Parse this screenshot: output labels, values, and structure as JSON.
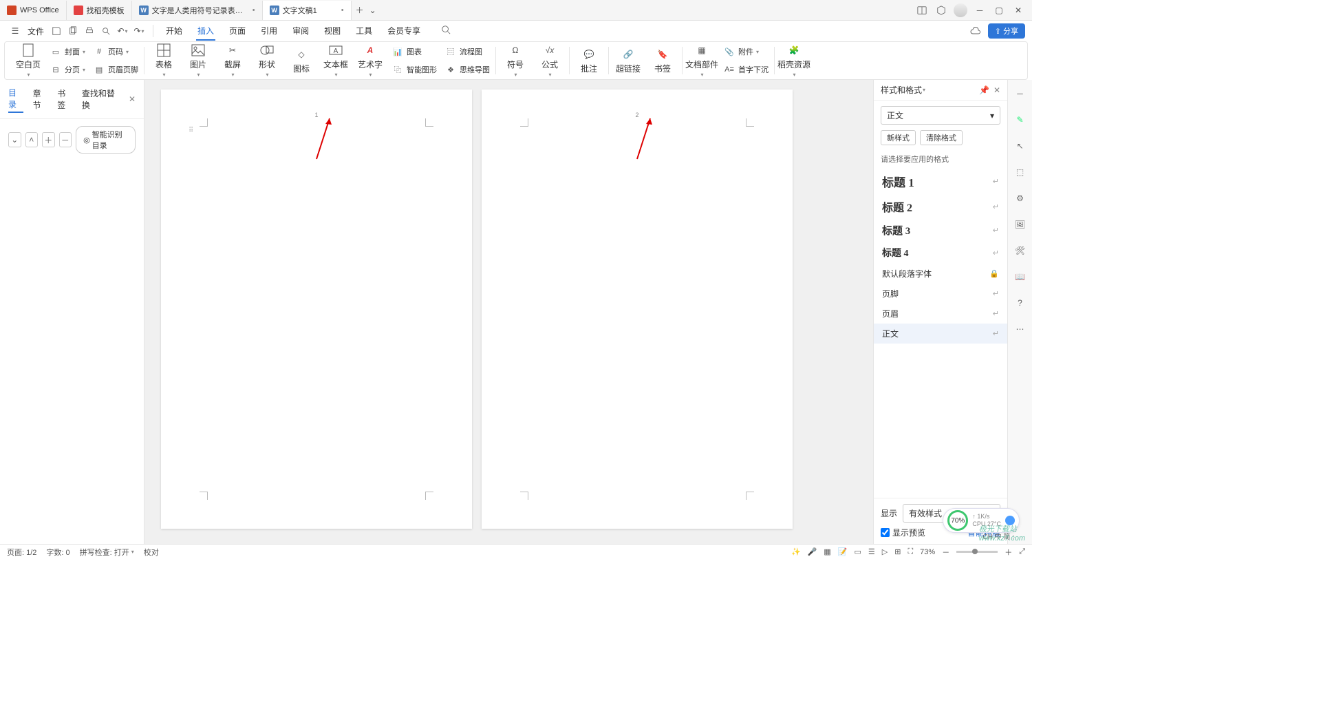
{
  "titlebar": {
    "app": "WPS Office",
    "tabs": [
      {
        "label": "找稻壳模板"
      },
      {
        "label": "文字是人类用符号记录表达信息以"
      },
      {
        "label": "文字文稿1"
      }
    ]
  },
  "quickaccess": {
    "file": "文件"
  },
  "menus": {
    "items": [
      "开始",
      "插入",
      "页面",
      "引用",
      "审阅",
      "视图",
      "工具",
      "会员专享"
    ],
    "active": "插入"
  },
  "share": "分享",
  "ribbon": {
    "blank": "空白页",
    "cover": "封面",
    "pagenum": "页码",
    "section": "分页",
    "headerfooter": "页眉页脚",
    "table": "表格",
    "picture": "图片",
    "screenshot": "截屏",
    "shape": "形状",
    "iconlib": "图标",
    "textbox": "文本框",
    "wordart": "艺术字",
    "chart": "图表",
    "flowchart": "流程图",
    "smartart": "智能图形",
    "mindmap": "思维导图",
    "symbol": "符号",
    "equation": "公式",
    "comment": "批注",
    "hyperlink": "超链接",
    "bookmark": "书签",
    "parts": "文档部件",
    "dropcap": "首字下沉",
    "attachment": "附件",
    "docer": "稻壳资源"
  },
  "leftpanel": {
    "tabs": [
      "目录",
      "章节",
      "书签",
      "查找和替换"
    ],
    "active": "目录",
    "smart": "智能识别目录"
  },
  "pages": {
    "p1": "1",
    "p2": "2"
  },
  "rightpanel": {
    "title": "样式和格式",
    "currentStyle": "正文",
    "newStyle": "新样式",
    "clear": "清除格式",
    "pick": "请选择要应用的格式",
    "styles": [
      {
        "name": "标题 1",
        "cls": "style-h1"
      },
      {
        "name": "标题 2",
        "cls": "style-h2"
      },
      {
        "name": "标题 3",
        "cls": "style-h3"
      },
      {
        "name": "标题 4",
        "cls": "style-h4"
      },
      {
        "name": "默认段落字体",
        "cls": "style-nm",
        "lock": true
      },
      {
        "name": "页脚",
        "cls": "style-nm"
      },
      {
        "name": "页眉",
        "cls": "style-nm"
      },
      {
        "name": "正文",
        "cls": "style-nm",
        "sel": true
      }
    ],
    "show": "显示",
    "showval": "有效样式",
    "preview": "显示预览",
    "smartlayout": "智能排版"
  },
  "statusbar": {
    "page": "页面: 1/2",
    "words": "字数: 0",
    "spell": "拼写检查: 打开",
    "proof": "校对",
    "zoom": "73%"
  },
  "float": {
    "perf": "70%",
    "net": "1K/s",
    "cpu": "CPU 27°C"
  },
  "ime": "CH 中 简 :",
  "watermark": "极光下载站\nwww.xz7.com"
}
